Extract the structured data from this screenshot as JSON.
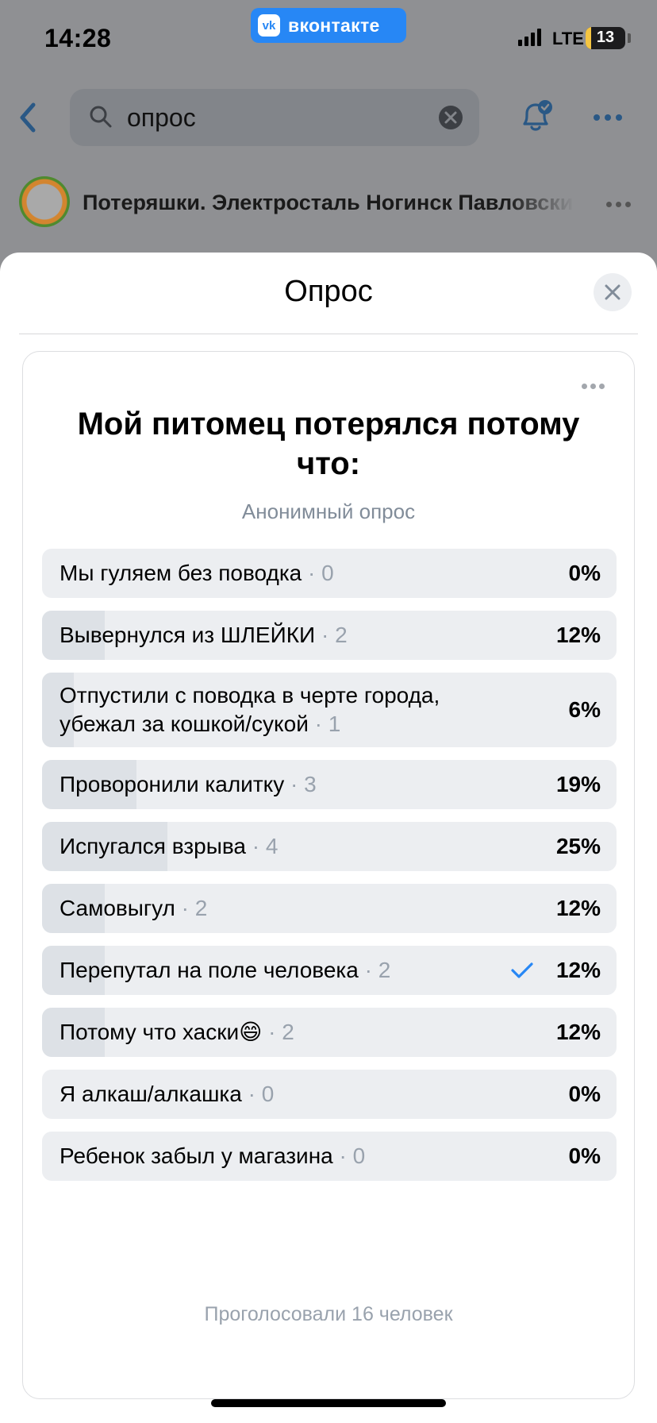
{
  "status_bar": {
    "time": "14:28",
    "app_pill": "вконтакте",
    "app_logo": "vk",
    "network": "LTE",
    "battery": "13",
    "battery_level": 0.13
  },
  "header": {
    "search_value": "опрос",
    "group_name": "Потеряшки. Электросталь Ногинск Павловский Посад"
  },
  "sheet": {
    "title": "Опрос"
  },
  "poll": {
    "question": "Мой питомец потерялся потому что:",
    "type": "Анонимный опрос",
    "options": [
      {
        "label": "Мы гуляем без поводка",
        "count": "0",
        "percent": "0%",
        "value": 0,
        "selected": false
      },
      {
        "label": "Вывернулся из ШЛЕЙКИ",
        "count": "2",
        "percent": "12%",
        "value": 12.5,
        "selected": false
      },
      {
        "label": "Отпустили с поводка в черте города, убежал за кошкой/сукой",
        "count": "1",
        "percent": "6%",
        "value": 6.25,
        "selected": false
      },
      {
        "label": "Проворонили калитку",
        "count": "3",
        "percent": "19%",
        "value": 18.75,
        "selected": false
      },
      {
        "label": "Испугался взрыва",
        "count": "4",
        "percent": "25%",
        "value": 25,
        "selected": false
      },
      {
        "label": "Самовыгул",
        "count": "2",
        "percent": "12%",
        "value": 12.5,
        "selected": false
      },
      {
        "label": "Перепутал на поле человека",
        "count": "2",
        "percent": "12%",
        "value": 12.5,
        "selected": true
      },
      {
        "label": "Потому что хаски😄",
        "count": "2",
        "percent": "12%",
        "value": 12.5,
        "selected": false
      },
      {
        "label": "Я алкаш/алкашка",
        "count": "0",
        "percent": "0%",
        "value": 0,
        "selected": false
      },
      {
        "label": "Ребенок забыл у магазина",
        "count": "0",
        "percent": "0%",
        "value": 0,
        "selected": false
      }
    ],
    "total": "Проголосовали 16 человек"
  },
  "colors": {
    "accent": "#2787f5",
    "option_bg": "#eceef1",
    "option_fill": "#dde1e6",
    "muted": "#99a2ad"
  }
}
